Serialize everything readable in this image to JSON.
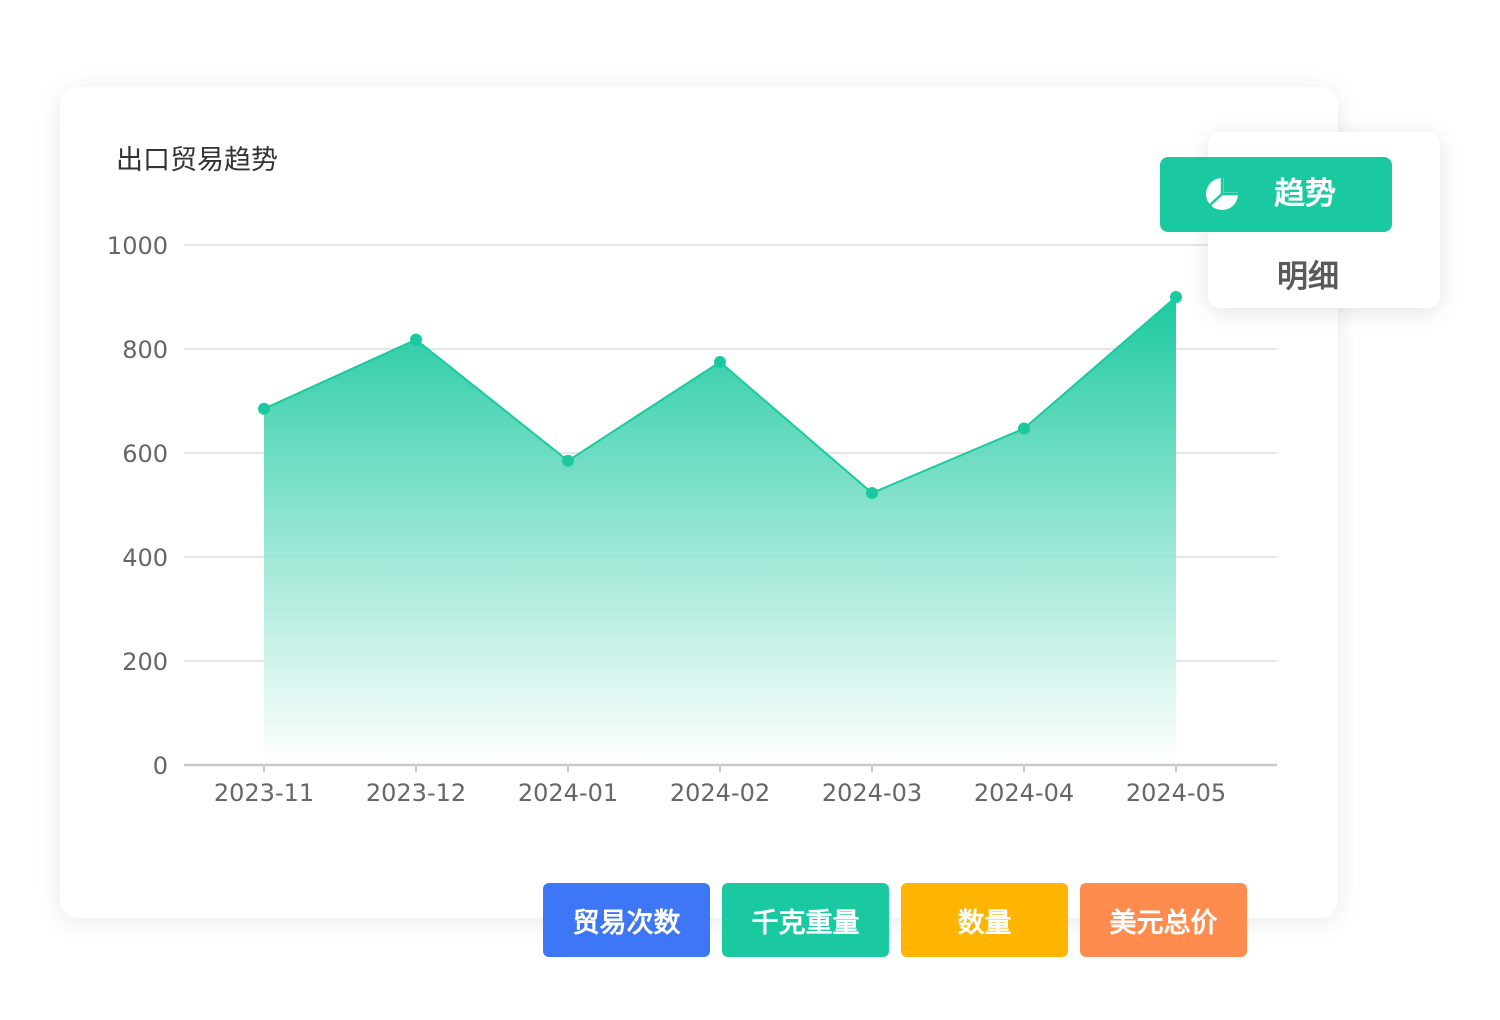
{
  "chart_title": "出口贸易趋势",
  "view_toggle": {
    "trend_label": "趋势",
    "detail_label": "明细",
    "active_icon": "pie-chart-icon"
  },
  "metric_buttons": [
    {
      "label": "贸易次数",
      "color": "#3d77f5"
    },
    {
      "label": "千克重量",
      "color": "#1bc9a0"
    },
    {
      "label": "数量",
      "color": "#ffb400"
    },
    {
      "label": "美元总价",
      "color": "#ff8c4f"
    }
  ],
  "chart_data": {
    "type": "area",
    "title": "出口贸易趋势",
    "categories": [
      "2023-11",
      "2023-12",
      "2024-01",
      "2024-02",
      "2024-03",
      "2024-04",
      "2024-05"
    ],
    "series": [
      {
        "values": [
          685,
          818,
          585,
          775,
          523,
          647,
          900
        ]
      }
    ],
    "yticks": [
      "0",
      "200",
      "400",
      "600",
      "800",
      "1000"
    ],
    "ylim": [
      0,
      1000
    ],
    "grid": true,
    "color": "#1bc9a0",
    "gradient_to": "#ffffff"
  }
}
